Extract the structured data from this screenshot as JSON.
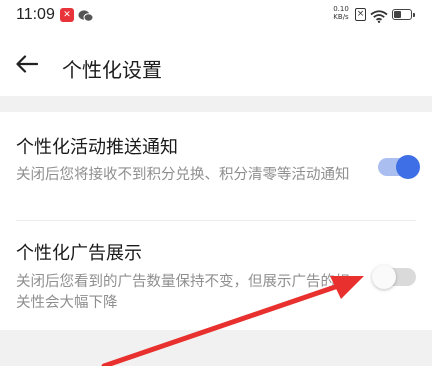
{
  "status_bar": {
    "time": "11:09",
    "net_speed_value": "0.10",
    "net_speed_unit": "KB/s"
  },
  "header": {
    "title": "个性化设置"
  },
  "settings": [
    {
      "title": "个性化活动推送通知",
      "description": "关闭后您将接收不到积分兑换、积分清零等活动通知",
      "enabled": true
    },
    {
      "title": "个性化广告展示",
      "description": "关闭后您看到的广告数量保持不变，但展示广告的相关性会大幅下降",
      "enabled": false
    }
  ],
  "colors": {
    "toggle_on": "#3f6fe6",
    "toggle_on_track": "#aabff0",
    "toggle_off_track": "#dadada",
    "annotation_arrow": "#e8312f"
  }
}
